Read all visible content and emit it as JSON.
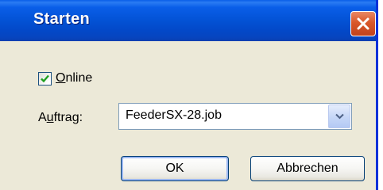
{
  "window": {
    "title": "Starten"
  },
  "online_checkbox": {
    "label_underlined": "O",
    "label_rest": "nline",
    "checked": true
  },
  "job_field": {
    "label_prefix": "A",
    "label_underlined": "u",
    "label_rest": "ftrag:",
    "value": "FeederSX-28.job"
  },
  "buttons": {
    "ok_label": "OK",
    "cancel_label": "Abbrechen"
  },
  "icons": {
    "close": "close-icon",
    "check": "checkmark-icon",
    "dropdown": "chevron-down-icon"
  },
  "colors": {
    "titlebar": "#0352d5",
    "dialog_background": "#ece9d8",
    "close_button": "#d9572a",
    "checkmark": "#21a121",
    "button_border": "#003c74"
  }
}
